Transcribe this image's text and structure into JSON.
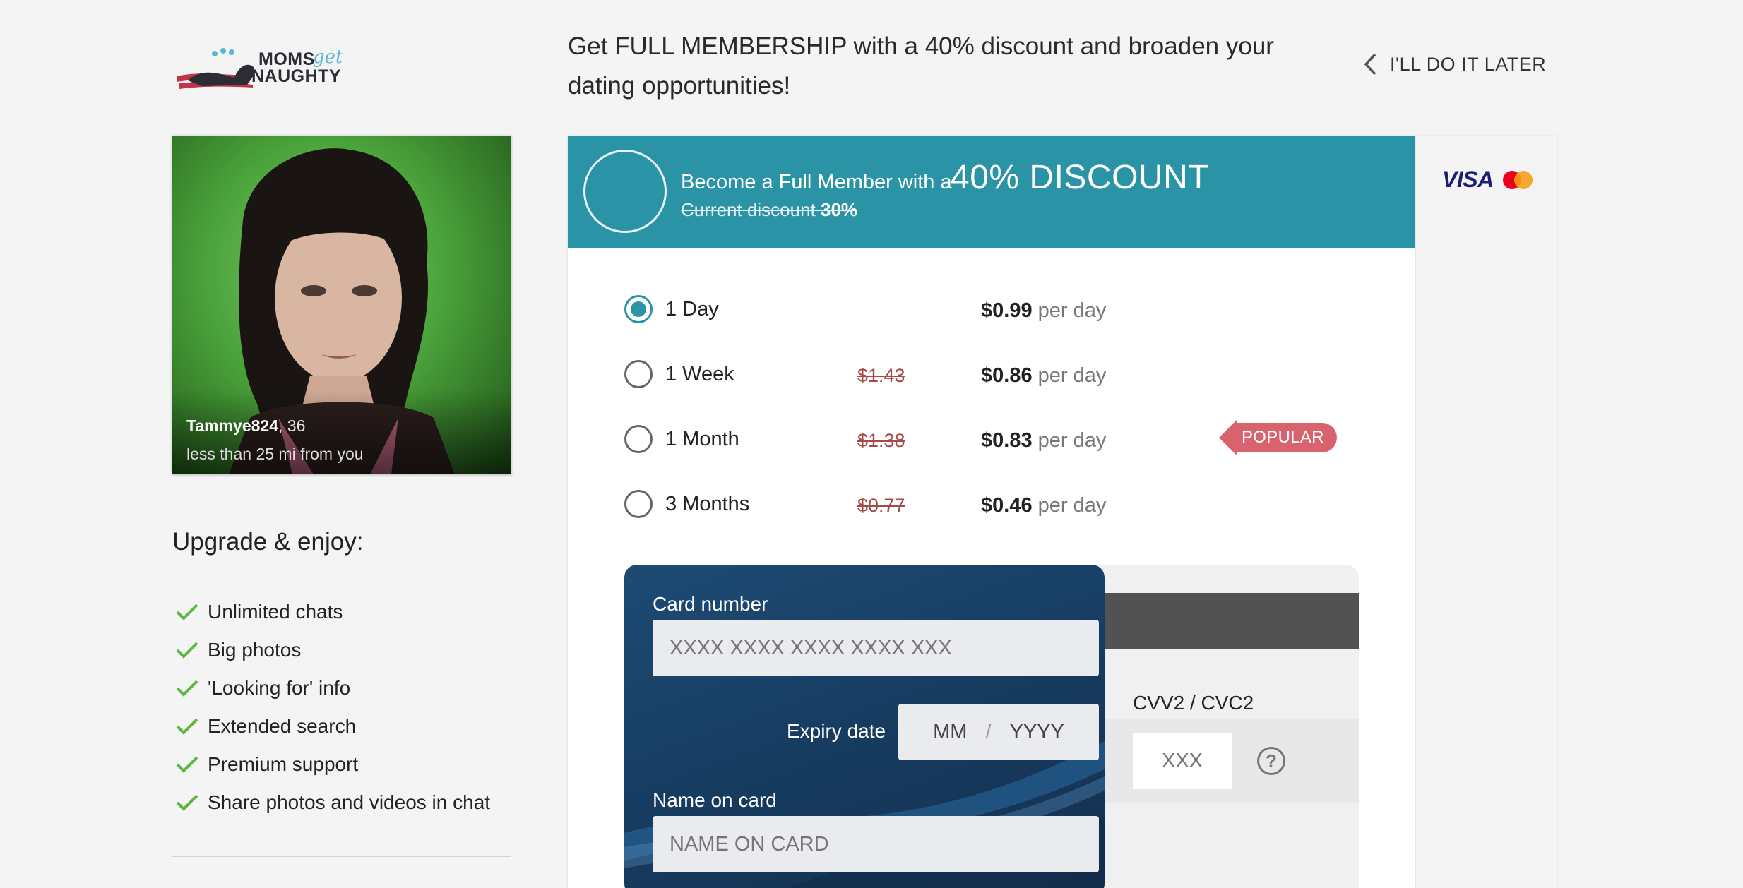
{
  "logo": {
    "word1": "MOMS",
    "word2": "get",
    "word3": "NAUGHTY"
  },
  "header": {
    "headline": "Get FULL MEMBERSHIP with a 40% discount and broaden your dating opportunities!",
    "later_label": "I'LL DO IT LATER"
  },
  "profile": {
    "name": "Tammye824",
    "age": ", 36",
    "distance": "less than 25 mi from you"
  },
  "upgrade": {
    "title": "Upgrade & enjoy:",
    "benefits": [
      "Unlimited chats",
      "Big photos",
      "'Looking for' info",
      "Extended search",
      "Premium support",
      "Share photos and videos in chat"
    ]
  },
  "banner": {
    "text": "Become a Full Member with a",
    "discount": "40% DISCOUNT",
    "current_label": "Current discount ",
    "current_value": "30%"
  },
  "brands": {
    "visa": "VISA",
    "mastercard_colors": [
      "#eb001b",
      "#f79e1b"
    ]
  },
  "plans": [
    {
      "label": "1 Day",
      "old_price": "",
      "price": "$0.99",
      "per": " per day",
      "selected": true
    },
    {
      "label": "1 Week",
      "old_price": "$1.43",
      "price": "$0.86",
      "per": " per day",
      "selected": false
    },
    {
      "label": "1 Month",
      "old_price": "$1.38",
      "price": "$0.83",
      "per": " per day",
      "selected": false
    },
    {
      "label": "3 Months",
      "old_price": "$0.77",
      "price": "$0.46",
      "per": " per day",
      "selected": false
    }
  ],
  "popular_label": "POPULAR",
  "card": {
    "number_label": "Card number",
    "number_placeholder": "XXXX XXXX XXXX XXXX XXX",
    "expiry_label": "Expiry date",
    "month_placeholder": "MM",
    "separator": "/",
    "year_placeholder": "YYYY",
    "name_label": "Name on card",
    "name_placeholder": "NAME ON CARD",
    "cvv_label": "CVV2 / CVC2",
    "cvv_placeholder": "XXX",
    "help": "?"
  },
  "colors": {
    "accent": "#2b93a6",
    "popular": "#d9626f",
    "check": "#5cb843",
    "card_dark": "#173d62"
  }
}
